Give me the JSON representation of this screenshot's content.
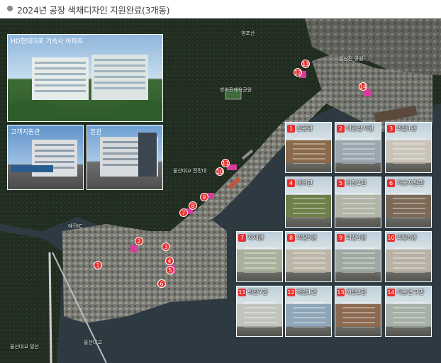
{
  "header": {
    "title": "2024년 공장 색채디자인 지원완료(3개동)"
  },
  "insets": {
    "main": "HD현대미포 기숙사 아파트",
    "customer": "고객지원관",
    "hq": "본관"
  },
  "tiles": [
    {
      "num": "1",
      "label": "신황관"
    },
    {
      "num": "2",
      "label": "대관상사원"
    },
    {
      "num": "3",
      "label": "의장1관"
    },
    {
      "num": "4",
      "label": "대의관"
    },
    {
      "num": "5",
      "label": "의장2관"
    },
    {
      "num": "6",
      "label": "기술지원관"
    },
    {
      "num": "7",
      "label": "자재관"
    },
    {
      "num": "8",
      "label": "의장5관"
    },
    {
      "num": "9",
      "label": "의장3관"
    },
    {
      "num": "10",
      "label": "의장6관"
    },
    {
      "num": "11",
      "label": "의장7관"
    },
    {
      "num": "12",
      "label": "해양1관"
    },
    {
      "num": "13",
      "label": "해양2관"
    },
    {
      "num": "14",
      "label": "기술연구관"
    }
  ],
  "map_labels": {
    "park": "방어진체육공원",
    "hill": "일산진 공원",
    "bridge_top": "울산대교 전망대",
    "bridge_name": "울산대교",
    "yeomp": "염포산",
    "road": "예전IC",
    "tunnel": "울산대교 일산"
  },
  "colors": {
    "accent_red": "#e6302f",
    "magenta": "#d63c9a",
    "water": "#2d3a44",
    "land": "#1e2a1e"
  }
}
